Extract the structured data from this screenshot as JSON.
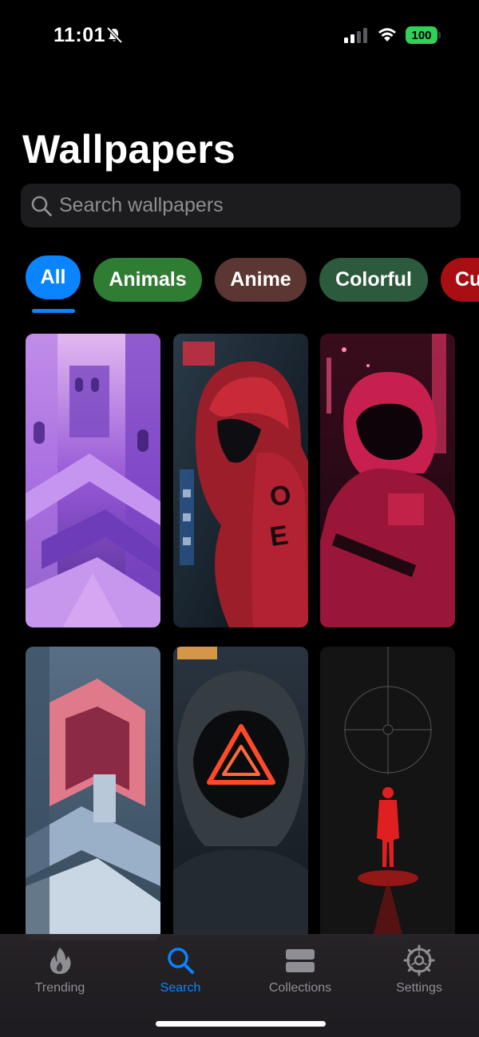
{
  "status": {
    "time": "11:01",
    "battery": "100",
    "battery_color": "#30d158"
  },
  "page": {
    "title": "Wallpapers"
  },
  "search": {
    "placeholder": "Search wallpapers",
    "value": ""
  },
  "categories": [
    {
      "label": "All",
      "color": "#0a84ff",
      "selected": true
    },
    {
      "label": "Animals",
      "color": "#2f7d32",
      "selected": false
    },
    {
      "label": "Anime",
      "color": "#5b3632",
      "selected": false
    },
    {
      "label": "Colorful",
      "color": "#2c5a3c",
      "selected": false
    },
    {
      "label": "Cu",
      "color": "#a80f12",
      "selected": false
    }
  ],
  "wallpapers": [
    {
      "name": "purple-escher-architecture",
      "palette": [
        "#b47ae8",
        "#6a3ea8"
      ]
    },
    {
      "name": "red-hooded-figure-city",
      "palette": [
        "#c22a36",
        "#1c2a36"
      ]
    },
    {
      "name": "pink-masked-soldier-neon",
      "palette": [
        "#e0336a",
        "#2a0c18"
      ]
    },
    {
      "name": "blue-red-geometric-stairs",
      "palette": [
        "#5c7389",
        "#b34358"
      ]
    },
    {
      "name": "neon-triangle-mask-hood",
      "palette": [
        "#ff5a3c",
        "#1c2226"
      ]
    },
    {
      "name": "red-figure-crosshair",
      "palette": [
        "#e22020",
        "#121212"
      ]
    }
  ],
  "tabs": [
    {
      "label": "Trending",
      "icon": "flame-icon",
      "active": false
    },
    {
      "label": "Search",
      "icon": "search-icon",
      "active": true
    },
    {
      "label": "Collections",
      "icon": "collections-icon",
      "active": false
    },
    {
      "label": "Settings",
      "icon": "gear-icon",
      "active": false
    }
  ],
  "colors": {
    "accent": "#0a84ff",
    "background": "#000000",
    "tab_inactive": "#8e8e93"
  }
}
